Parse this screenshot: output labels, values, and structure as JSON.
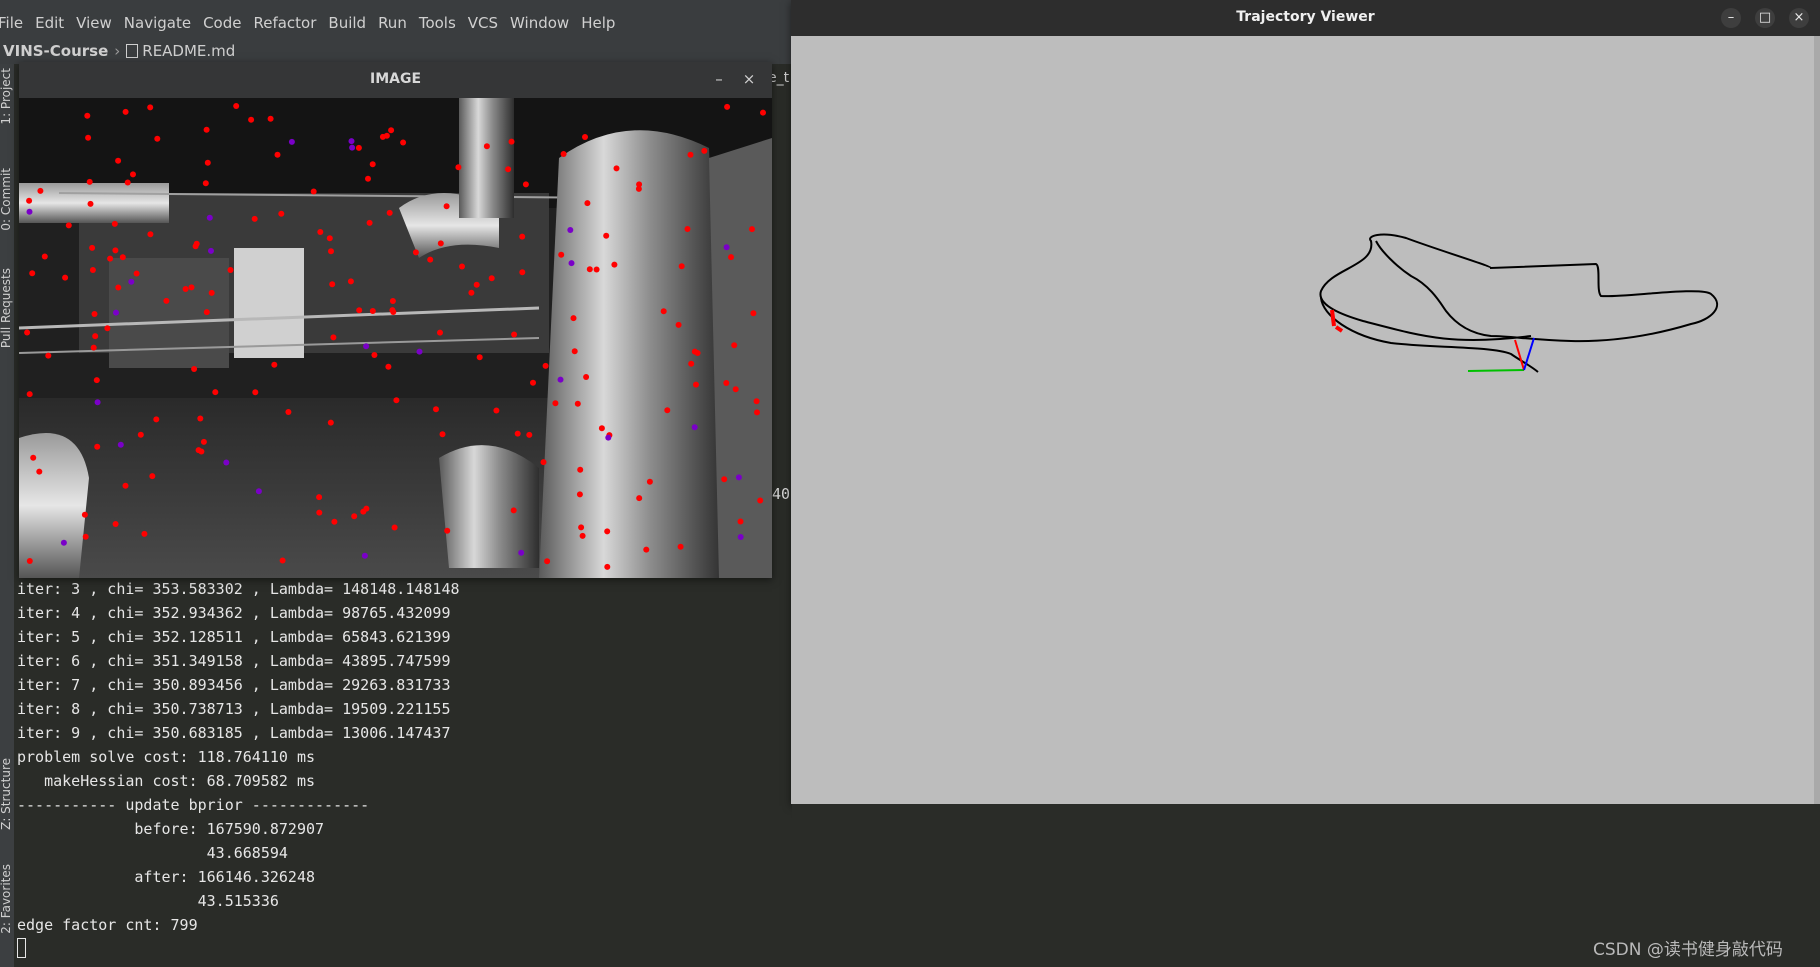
{
  "ide": {
    "menu": [
      "File",
      "Edit",
      "View",
      "Navigate",
      "Code",
      "Refactor",
      "Build",
      "Run",
      "Tools",
      "VCS",
      "Window",
      "Help"
    ],
    "breadcrumb": {
      "project": "VINS-Course",
      "separator": "›",
      "file": "README.md"
    },
    "side_tabs": [
      "1: Project",
      "0: Commit",
      "Pull Requests",
      "Z: Structure",
      "2: Favorites"
    ],
    "edge_text": "e_t",
    "edge_number": "40"
  },
  "terminal": {
    "lines": [
      "iter: 3 , chi= 353.583302 , Lambda= 148148.148148",
      "iter: 4 , chi= 352.934362 , Lambda= 98765.432099",
      "iter: 5 , chi= 352.128511 , Lambda= 65843.621399",
      "iter: 6 , chi= 351.349158 , Lambda= 43895.747599",
      "iter: 7 , chi= 350.893456 , Lambda= 29263.831733",
      "iter: 8 , chi= 350.738713 , Lambda= 19509.221155",
      "iter: 9 , chi= 350.683185 , Lambda= 13006.147437",
      "problem solve cost: 118.764110 ms",
      "   makeHessian cost: 68.709582 ms",
      "----------- update bprior -------------",
      "             before: 167590.872907",
      "                     43.668594",
      "             after: 166146.326248",
      "                    43.515336",
      "edge factor cnt: 799"
    ]
  },
  "image_window": {
    "title": "IMAGE",
    "minimize": "–",
    "close": "×"
  },
  "trajectory_window": {
    "title": "Trajectory Viewer",
    "minimize": "–",
    "maximize": "□",
    "close": "×"
  },
  "watermark": "CSDN @读书健身敲代码",
  "colors": {
    "feature_tracked": "#ff0000",
    "feature_new": "#7a00c8",
    "trajectory": "#000000",
    "axis_x": "#ff0000",
    "axis_y": "#00c000",
    "axis_z": "#0000ff"
  }
}
